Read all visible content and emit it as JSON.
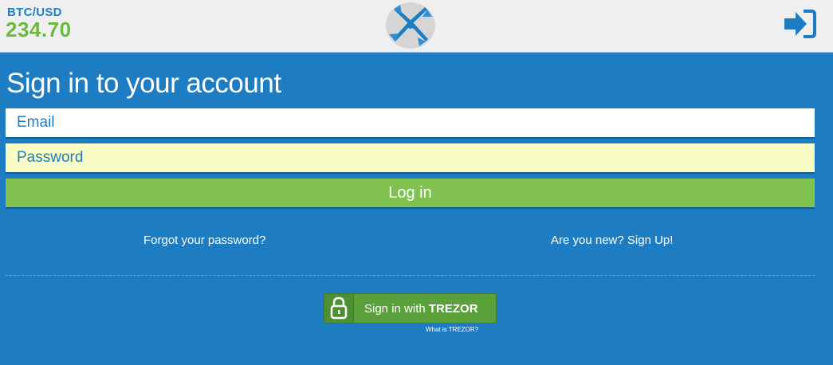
{
  "header": {
    "ticker_pair": "BTC/USD",
    "ticker_price": "234.70",
    "logo_icon": "propeller-logo-icon",
    "login_icon": "sign-in-arrow-icon"
  },
  "form": {
    "title": "Sign in to your account",
    "email_placeholder": "Email",
    "password_placeholder": "Password",
    "login_label": "Log in"
  },
  "links": {
    "forgot": "Forgot your password?",
    "signup": "Are you new? Sign Up!"
  },
  "trezor": {
    "label_prefix": "Sign in with ",
    "label_brand": "TREZOR",
    "what_is": "What is TREZOR?",
    "icon": "lock-icon"
  },
  "colors": {
    "header_bg": "#efefef",
    "main_bg": "#1e7cc3",
    "pair_text": "#1f7fc6",
    "price_text": "#6cb93f",
    "login_button": "#80c150",
    "password_bg": "#fafdc3",
    "trezor_button": "#5aa13c"
  }
}
